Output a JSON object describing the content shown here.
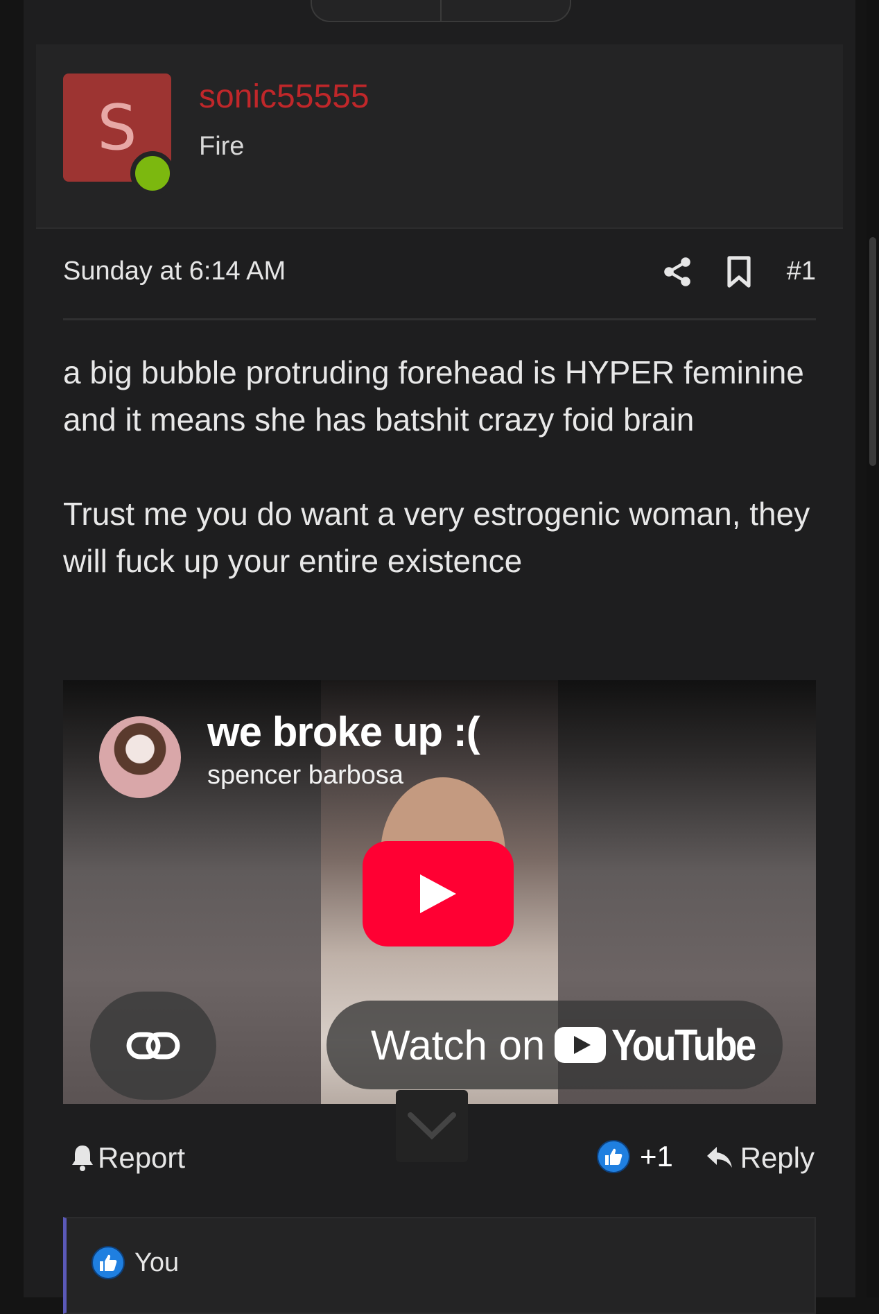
{
  "post": {
    "username": "sonic55555",
    "avatar_letter": "S",
    "user_title": "Fire",
    "date": "Sunday at 6:14 AM",
    "post_number": "#1",
    "body_paragraphs": [
      "a big bubble protruding forehead is HYPER feminine and it means she has batshit crazy foid brain",
      "Trust me you do want a very estrogenic woman, they will fuck up your entire existence"
    ]
  },
  "video": {
    "title": "we broke up :(",
    "channel": "spencer barbosa",
    "watch_label": "Watch on",
    "platform": "YouTube"
  },
  "actions": {
    "report_label": "Report",
    "like_count": "+1",
    "reply_label": "Reply"
  },
  "reactions": {
    "label": "You"
  },
  "colors": {
    "username": "#c0272a",
    "avatar_bg": "#9d3432",
    "online": "#7cb80f",
    "youtube_red": "#ff0033",
    "like_blue": "#1f7fe0",
    "reaction_border": "#5b59b8"
  },
  "icons": [
    "share-icon",
    "bookmark-icon",
    "play-icon",
    "link-icon",
    "youtube-logo-icon",
    "chevron-down-icon",
    "bell-icon",
    "like-icon",
    "reply-icon"
  ]
}
